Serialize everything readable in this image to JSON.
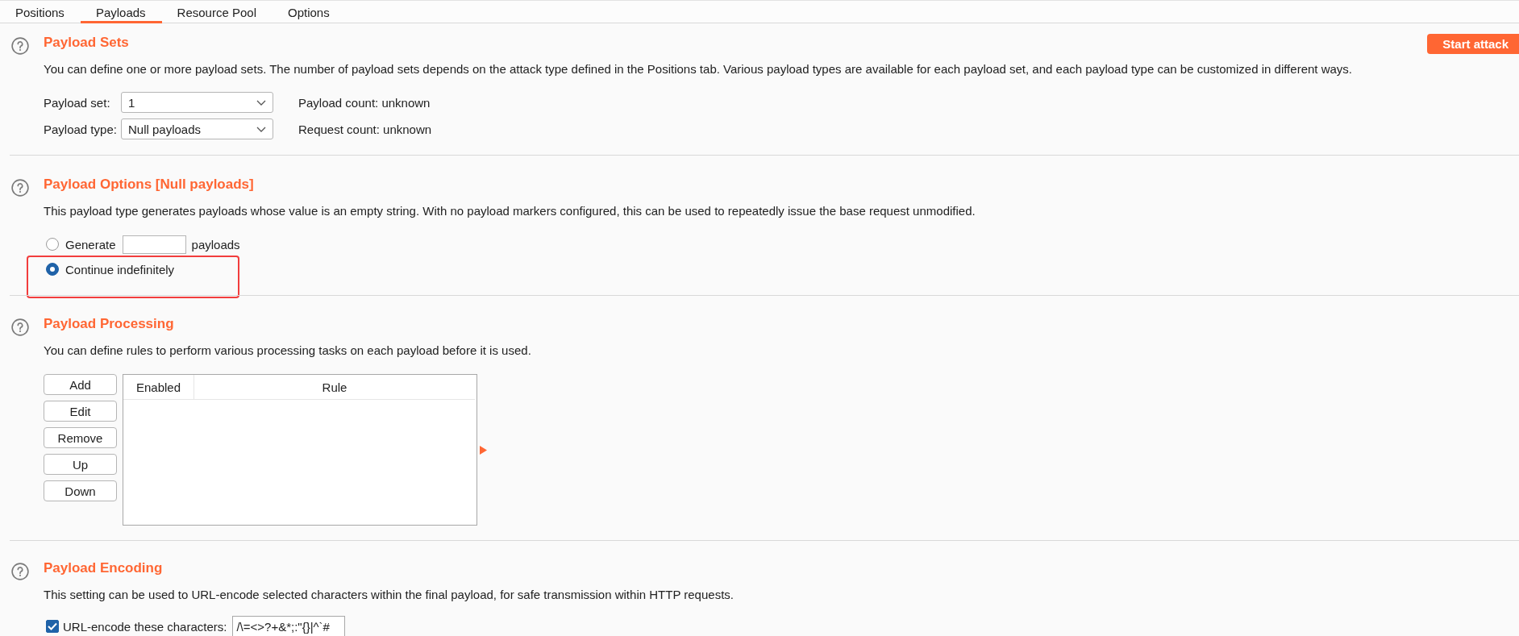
{
  "tabs": [
    {
      "label": "Positions",
      "selected": false
    },
    {
      "label": "Payloads",
      "selected": true
    },
    {
      "label": "Resource Pool",
      "selected": false
    },
    {
      "label": "Options",
      "selected": false
    }
  ],
  "start_button": "Start attack",
  "payload_sets": {
    "title": "Payload Sets",
    "description": "You can define one or more payload sets. The number of payload sets depends on the attack type defined in the Positions tab. Various payload types are available for each payload set, and each payload type can be customized in different ways.",
    "fields": [
      {
        "label": "Payload set:",
        "value": "1",
        "info": "Payload count: unknown"
      },
      {
        "label": "Payload type:",
        "value": "Null payloads",
        "info": "Request count: unknown"
      }
    ]
  },
  "payload_options": {
    "title": "Payload Options [Null payloads]",
    "description": "This payload type generates payloads whose value is an empty string. With no payload markers configured, this can be used to repeatedly issue the base request unmodified.",
    "options": [
      {
        "kind": "count",
        "label": "Generate",
        "suffix": "payloads",
        "selected": false,
        "highlighted": false
      },
      {
        "kind": "plain",
        "label": "Continue indefinitely",
        "selected": true,
        "highlighted": true
      }
    ]
  },
  "payload_processing": {
    "title": "Payload Processing",
    "description": "You can define rules to perform various processing tasks on each payload before it is used.",
    "buttons": [
      "Add",
      "Edit",
      "Remove",
      "Up",
      "Down"
    ],
    "table": {
      "columns": [
        "Enabled",
        "Rule"
      ]
    }
  },
  "payload_encoding": {
    "title": "Payload Encoding",
    "description": "This setting can be used to URL-encode selected characters within the final payload, for safe transmission within HTTP requests.",
    "checkbox": {
      "label": "URL-encode these characters:",
      "checked": true,
      "value": "/\\=<>?+&*;:\"{}|^`#"
    }
  }
}
